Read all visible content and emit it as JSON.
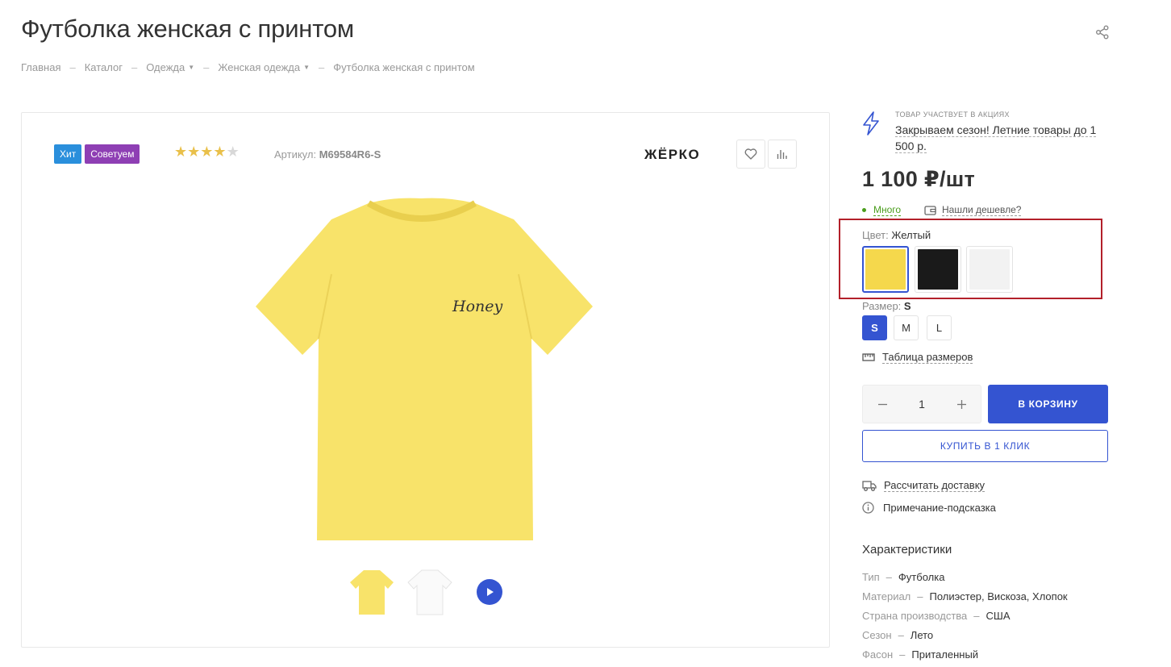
{
  "title": "Футболка женская с принтом",
  "breadcrumb": {
    "home": "Главная",
    "catalog": "Каталог",
    "clothes": "Одежда",
    "womens": "Женская одежда",
    "current": "Футболка женская с принтом",
    "separator": "–"
  },
  "gallery": {
    "badges": {
      "hit": "Хит",
      "advise": "Советуем"
    },
    "rating": {
      "value": 4,
      "max": 5
    },
    "article_label": "Артикул:",
    "article_value": "M69584R6-S",
    "brand": "ЖЁРКО",
    "main_image_color": "#f8e36a",
    "main_image_text": "Honey"
  },
  "promo": {
    "label": "ТОВАР УЧАСТВУЕТ В АКЦИЯХ",
    "text": "Закрываем сезон! Летние товары до 1 500 р."
  },
  "price": "1 100 ₽/шт",
  "stock": "Много",
  "cheaper": "Нашли дешевле?",
  "color": {
    "label": "Цвет:",
    "value": "Желтый",
    "swatches": [
      {
        "name": "yellow",
        "hex": "#f5d84c"
      },
      {
        "name": "black",
        "hex": "#1a1a1a"
      },
      {
        "name": "white",
        "hex": "#f2f2f2"
      }
    ]
  },
  "size": {
    "label": "Размер:",
    "value": "S",
    "options": [
      "S",
      "M",
      "L"
    ]
  },
  "size_table": "Таблица размеров",
  "quantity": "1",
  "cart_button": "В КОРЗИНУ",
  "oneclick_button": "КУПИТЬ В 1 КЛИК",
  "delivery": "Рассчитать доставку",
  "hint": "Примечание-подсказка",
  "specs": {
    "title": "Характеристики",
    "separator": "–",
    "rows": [
      {
        "key": "Тип",
        "value": "Футболка"
      },
      {
        "key": "Материал",
        "value": "Полиэстер, Вискоза, Хлопок"
      },
      {
        "key": "Страна производства",
        "value": "США"
      },
      {
        "key": "Сезон",
        "value": "Лето"
      },
      {
        "key": "Фасон",
        "value": "Приталенный"
      }
    ]
  },
  "colors": {
    "accent": "#3454d1",
    "highlight": "#b3202a",
    "stock": "#4a9d1c"
  }
}
